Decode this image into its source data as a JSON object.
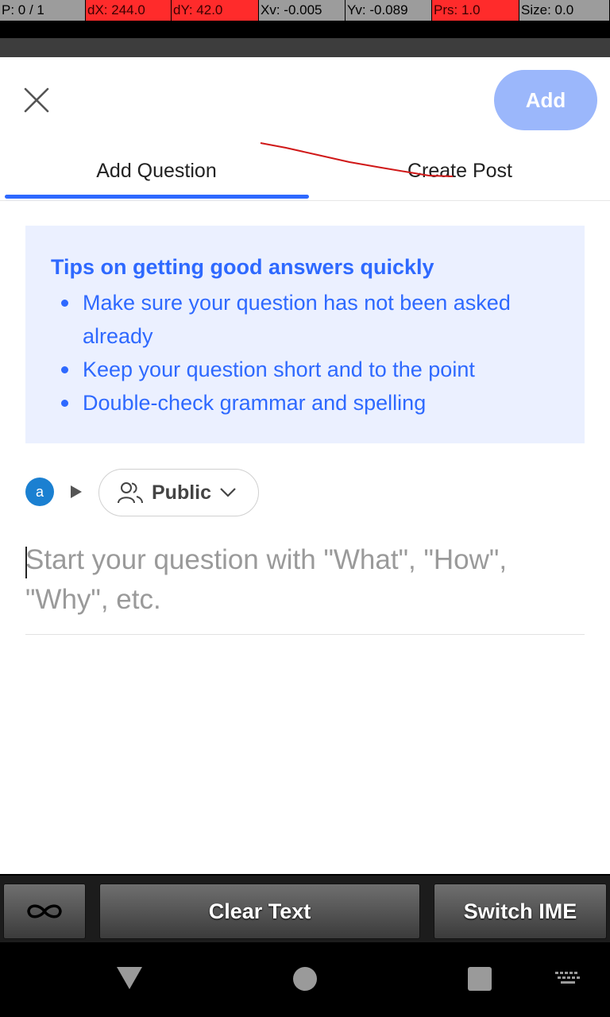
{
  "pointer_info": {
    "p": "P: 0 / 1",
    "dx": "dX: 244.0",
    "dy": "dY: 42.0",
    "xv": "Xv: -0.005",
    "yv": "Yv: -0.089",
    "prs": "Prs: 1.0",
    "size": "Size: 0.0"
  },
  "header": {
    "close_icon": "close-icon",
    "add_label": "Add"
  },
  "tabs": [
    {
      "label": "Add Question",
      "active": true
    },
    {
      "label": "Create Post",
      "active": false
    }
  ],
  "tips": {
    "title": "Tips on getting good answers quickly",
    "items": [
      "Make sure your question has not been asked already",
      "Keep your question short and to the point",
      "Double-check grammar and spelling"
    ]
  },
  "audience": {
    "avatar_letter": "a",
    "visibility_label": "Public"
  },
  "question": {
    "value": "",
    "placeholder": "Start your question with \"What\", \"How\", \"Why\", etc."
  },
  "keyboard_bar": {
    "infinity_icon": "infinity-icon",
    "clear_text_label": "Clear Text",
    "switch_ime_label": "Switch IME"
  },
  "colors": {
    "accent": "#2e69ff",
    "add_button": "#9bb7fb",
    "tips_background": "#ebf0ff",
    "avatar": "#1b80d1",
    "debug_red": "#ff2b2b"
  }
}
